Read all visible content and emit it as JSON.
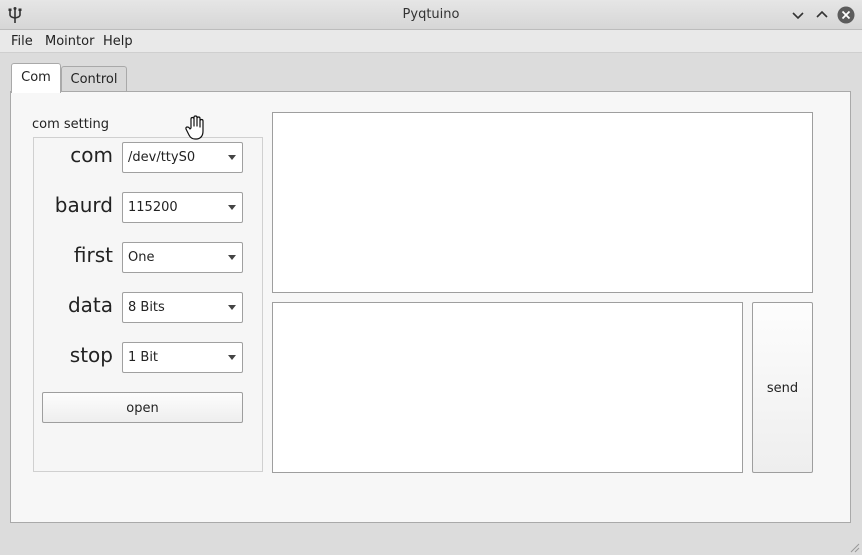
{
  "window": {
    "title": "Pyqtuino",
    "app_icon": "usb-trident-icon",
    "controls": [
      "chevron-down-icon",
      "chevron-up-icon",
      "close-circle-icon"
    ]
  },
  "menu": {
    "file": "File",
    "monitor": "Mointor",
    "help": "Help"
  },
  "tabs": {
    "com": "Com",
    "control": "Control",
    "active": "Com"
  },
  "com_setting": {
    "title": "com setting",
    "com": {
      "label": "com",
      "value": "/dev/ttyS0"
    },
    "baud": {
      "label": "baurd",
      "value": "115200"
    },
    "first": {
      "label": "first",
      "value": "One"
    },
    "data": {
      "label": "data",
      "value": "8 Bits"
    },
    "stop": {
      "label": "stop",
      "value": "1 Bit"
    },
    "open_button": "open"
  },
  "send_button": "send",
  "receive_text": "",
  "send_text": "",
  "colors": {
    "window_bg": "#dcdcdc",
    "panel_bg": "#f7f7f7",
    "field_bg": "#ffffff",
    "close_button": "#5c5c5c"
  }
}
